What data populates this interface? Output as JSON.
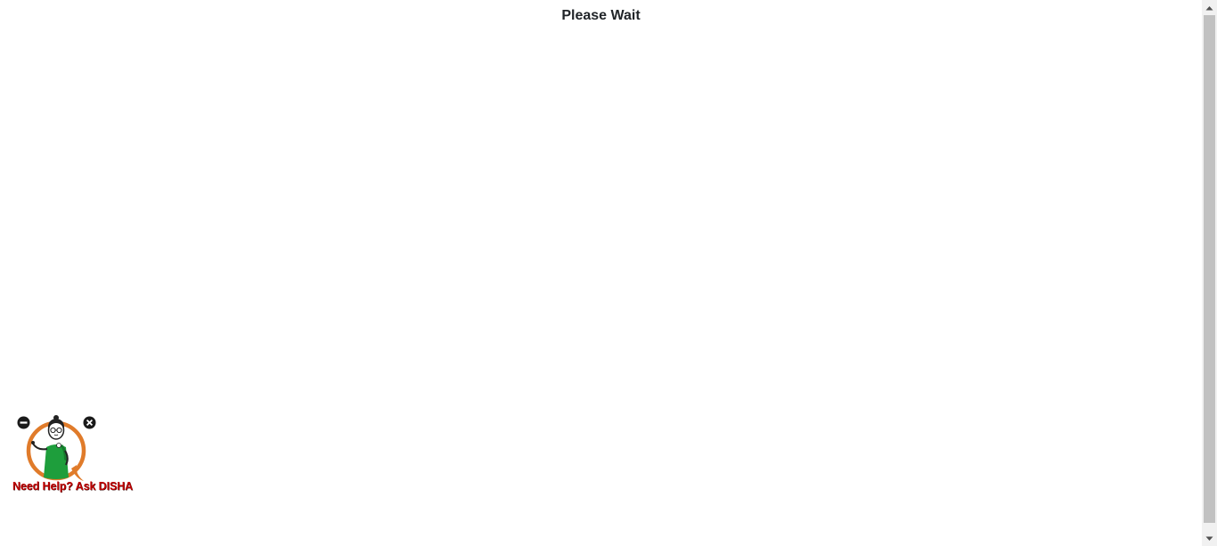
{
  "main": {
    "title": "Please Wait"
  },
  "disha_widget": {
    "help_text": "Need Help? Ask DISHA",
    "minimize_icon": "minus-circle-icon",
    "close_icon": "close-circle-icon",
    "avatar": "disha-assistant-avatar",
    "colors": {
      "ring": "#e07b2a",
      "dress": "#1e9e3c",
      "text": "#c00000"
    }
  },
  "scrollbar": {
    "up_icon": "arrow-up-icon",
    "down_icon": "arrow-down-icon"
  }
}
